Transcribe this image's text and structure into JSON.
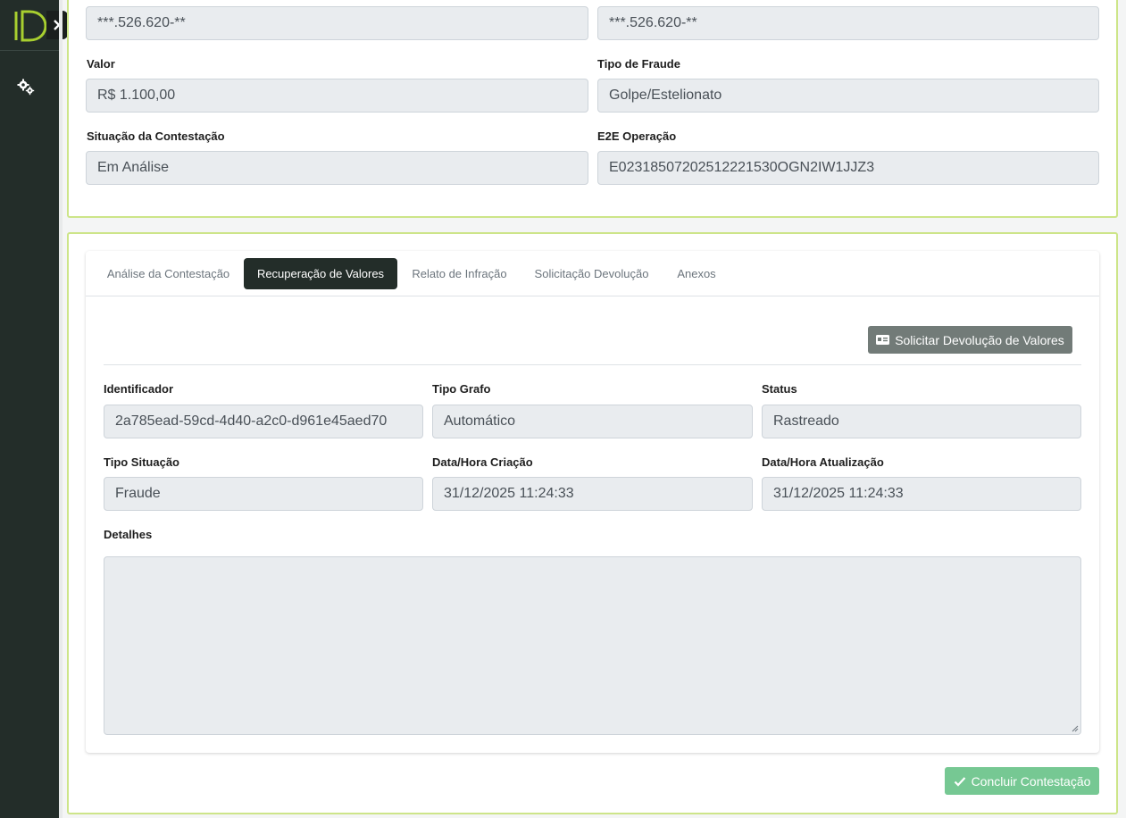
{
  "top_card": {
    "masked_doc_left": "***.526.620-**",
    "masked_doc_right": "***.526.620-**",
    "valor_label": "Valor",
    "valor_value": "R$ 1.100,00",
    "tipo_fraude_label": "Tipo de Fraude",
    "tipo_fraude_value": "Golpe/Estelionato",
    "situacao_label": "Situação da Contestação",
    "situacao_value": "Em Análise",
    "e2e_label": "E2E Operação",
    "e2e_value": "E02318507202512221530OGN2IW1JJZ3"
  },
  "tabs": [
    {
      "label": "Análise da Contestação",
      "active": false
    },
    {
      "label": "Recuperação de Valores",
      "active": true
    },
    {
      "label": "Relato de Infração",
      "active": false
    },
    {
      "label": "Solicitação Devolução",
      "active": false
    },
    {
      "label": "Anexos",
      "active": false
    }
  ],
  "recuperacao": {
    "solicitar_button": "Solicitar Devolução de Valores",
    "identificador_label": "Identificador",
    "identificador_value": "2a785ead-59cd-4d40-a2c0-d961e45aed70",
    "tipo_grafo_label": "Tipo Grafo",
    "tipo_grafo_value": "Automático",
    "status_label": "Status",
    "status_value": "Rastreado",
    "tipo_situacao_label": "Tipo Situação",
    "tipo_situacao_value": "Fraude",
    "criacao_label": "Data/Hora Criação",
    "criacao_value": "31/12/2025 11:24:33",
    "atualizacao_label": "Data/Hora Atualização",
    "atualizacao_value": "31/12/2025 11:24:33",
    "detalhes_label": "Detalhes",
    "detalhes_value": ""
  },
  "footer": {
    "concluir_button": "Concluir Contestação"
  },
  "colors": {
    "sidebar": "#232d29",
    "card_border": "#cde589",
    "active_tab": "#232d29",
    "solicitar_button": "#727b78",
    "concluir_button": "#76c893"
  }
}
